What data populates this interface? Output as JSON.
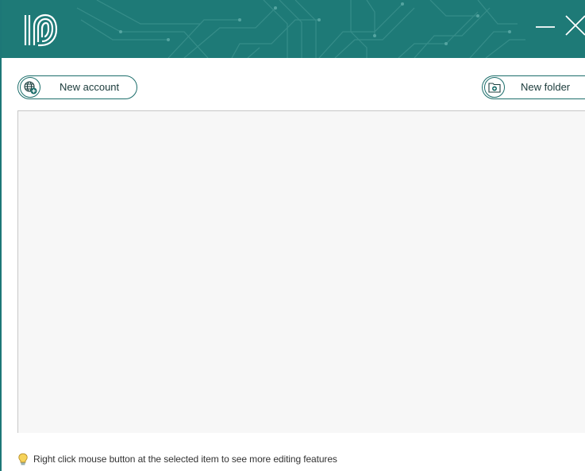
{
  "titlebar": {
    "logo_icon": "fingerprint-id-logo",
    "minimize_icon": "minimize-icon",
    "close_icon": "close-icon",
    "background_color": "#1e7a77"
  },
  "toolbar": {
    "new_account_label": "New account",
    "new_account_icon": "globe-add-icon",
    "new_folder_label": "New folder",
    "new_folder_icon": "folder-add-icon",
    "accent_color": "#1c6e6b"
  },
  "list": {
    "items": []
  },
  "footer": {
    "hint_icon": "lightbulb-icon",
    "hint_text": "Right click mouse button at the selected item to see more editing features"
  }
}
